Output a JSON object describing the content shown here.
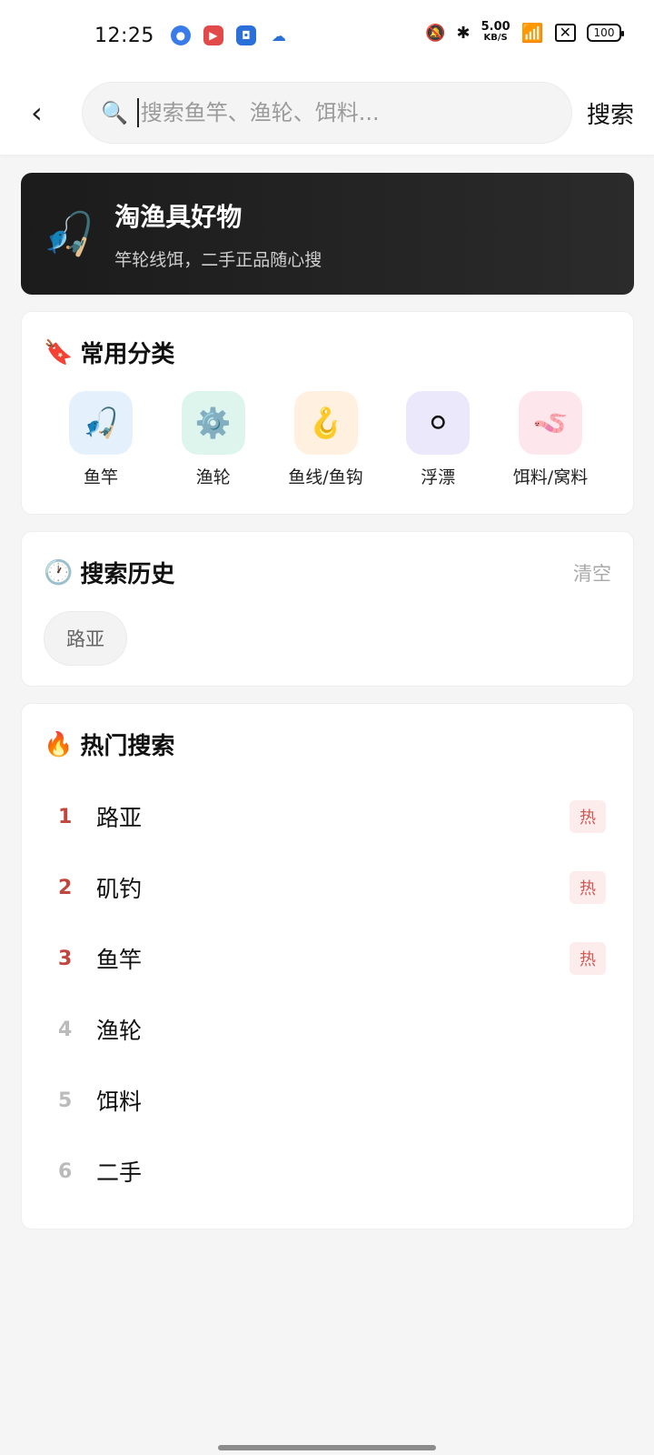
{
  "status_bar": {
    "time": "12:25",
    "network_speed": "5.00",
    "network_unit": "KB/S",
    "battery": "100",
    "app_icons": [
      "browser-icon",
      "video-icon",
      "security-icon",
      "cloud-icon"
    ]
  },
  "search": {
    "placeholder": "搜索鱼竿、渔轮、饵料...",
    "value": "",
    "button_label": "搜索"
  },
  "banner": {
    "title": "淘渔具好物",
    "subtitle": "竿轮线饵，二手正品随心搜",
    "icon": "🎣"
  },
  "categories_section": {
    "title": "常用分类",
    "icon": "🔖",
    "items": [
      {
        "label": "鱼竿",
        "icon": "🎣",
        "bg": "#e5f0fd"
      },
      {
        "label": "渔轮",
        "icon": "⚙️",
        "bg": "#def5ee"
      },
      {
        "label": "鱼线/鱼钩",
        "icon": "🪝",
        "bg": "#fff0e0"
      },
      {
        "label": "浮漂",
        "icon": "⚪",
        "bg": "#ece8fc"
      },
      {
        "label": "饵料/窝料",
        "icon": "🪱",
        "bg": "#fde6ec"
      }
    ]
  },
  "history_section": {
    "title": "搜索历史",
    "icon": "🕐",
    "clear_label": "清空",
    "items": [
      "路亚"
    ]
  },
  "hot_section": {
    "title": "热门搜索",
    "icon": "🔥",
    "items": [
      {
        "rank": "1",
        "label": "路亚",
        "tag": "热"
      },
      {
        "rank": "2",
        "label": "矶钓",
        "tag": "热"
      },
      {
        "rank": "3",
        "label": "鱼竿",
        "tag": "热"
      },
      {
        "rank": "4",
        "label": "渔轮",
        "tag": ""
      },
      {
        "rank": "5",
        "label": "饵料",
        "tag": ""
      },
      {
        "rank": "6",
        "label": "二手",
        "tag": ""
      }
    ]
  },
  "colors": {
    "hot_rank": "#c0463e",
    "hot_tag_bg": "#fdecec",
    "banner_bg": "#1b1b1b"
  }
}
